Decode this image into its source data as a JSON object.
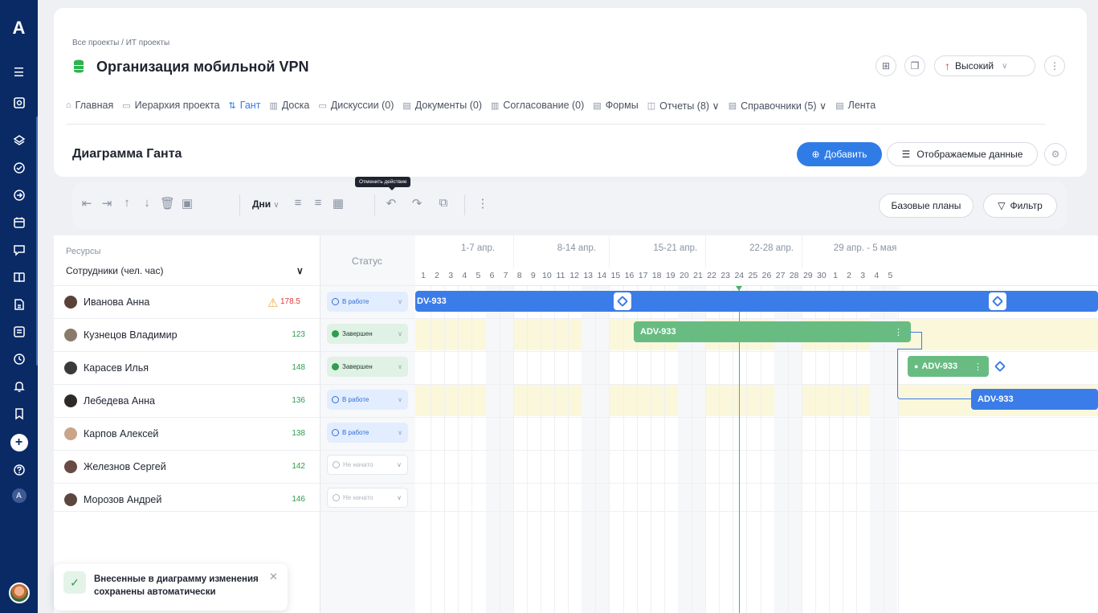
{
  "sidebar": {
    "logo": "A",
    "plus": "+",
    "avatar_letter": "A"
  },
  "header": {
    "breadcrumb": "Все проекты  /  ИТ проекты",
    "title": "Организация мобильной VPN",
    "priority": "Высокий"
  },
  "tabs": [
    {
      "icon": "⌂",
      "label": "Главная"
    },
    {
      "icon": "▭",
      "label": "Иерархия проекта"
    },
    {
      "icon": "⇅",
      "label": "Гант"
    },
    {
      "icon": "▥",
      "label": "Доска"
    },
    {
      "icon": "▭",
      "label": "Дискуссии (0)"
    },
    {
      "icon": "▤",
      "label": "Документы (0)"
    },
    {
      "icon": "▥",
      "label": "Согласование (0)"
    },
    {
      "icon": "▤",
      "label": "Формы"
    },
    {
      "icon": "◫",
      "label": "Отчеты (8)  ∨"
    },
    {
      "icon": "▤",
      "label": "Справочники (5)  ∨"
    },
    {
      "icon": "▤",
      "label": "Лента"
    }
  ],
  "gantt": {
    "title": "Диаграмма Ганта",
    "add_label": "Добавить",
    "data_label": "Отображаемые данные",
    "days_label": "Дни",
    "tooltip": "Отменить действие",
    "baselines_label": "Базовые планы",
    "filter_label": "Фильтр"
  },
  "table": {
    "resources_label": "Ресурсы",
    "employees_label": "Сотрудники (чел. час)",
    "status_label": "Статус",
    "rows": [
      {
        "name": "Иванова Анна",
        "hours": "178.5",
        "status": "В работе"
      },
      {
        "name": "Кузнецов Владимир",
        "hours": "123",
        "status": "Завершен"
      },
      {
        "name": "Карасев Илья",
        "hours": "148",
        "status": "Завершен"
      },
      {
        "name": "Лебедева Анна",
        "hours": "136",
        "status": "В работе"
      },
      {
        "name": "Карпов Алексей",
        "hours": "138",
        "status": "В работе"
      },
      {
        "name": "Железнов Сергей",
        "hours": "142",
        "status": "Не начато"
      },
      {
        "name": "Морозов Андрей",
        "hours": "146",
        "status": "Не начато"
      }
    ]
  },
  "timeline": {
    "weeks": [
      "1-7 апр.",
      "8-14 апр.",
      "15-21 апр.",
      "22-28 апр.",
      "29 апр. - 5 мая"
    ],
    "days": [
      "1",
      "2",
      "3",
      "4",
      "5",
      "6",
      "7",
      "8",
      "9",
      "10",
      "11",
      "12",
      "13",
      "14",
      "15",
      "16",
      "17",
      "18",
      "19",
      "20",
      "21",
      "22",
      "23",
      "24",
      "25",
      "26",
      "27",
      "28",
      "29",
      "30",
      "1",
      "2",
      "3",
      "4",
      "5"
    ],
    "task_1_label": "DV-933",
    "task_2_label": "ADV-933",
    "task_3_label": "ADV-933",
    "task_4_label": "ADV-933",
    "more_glyph": "⋮"
  },
  "toast": {
    "text": "Внесенные в диаграмму изменения сохранены автоматически",
    "check": "✓",
    "close": "✕"
  }
}
